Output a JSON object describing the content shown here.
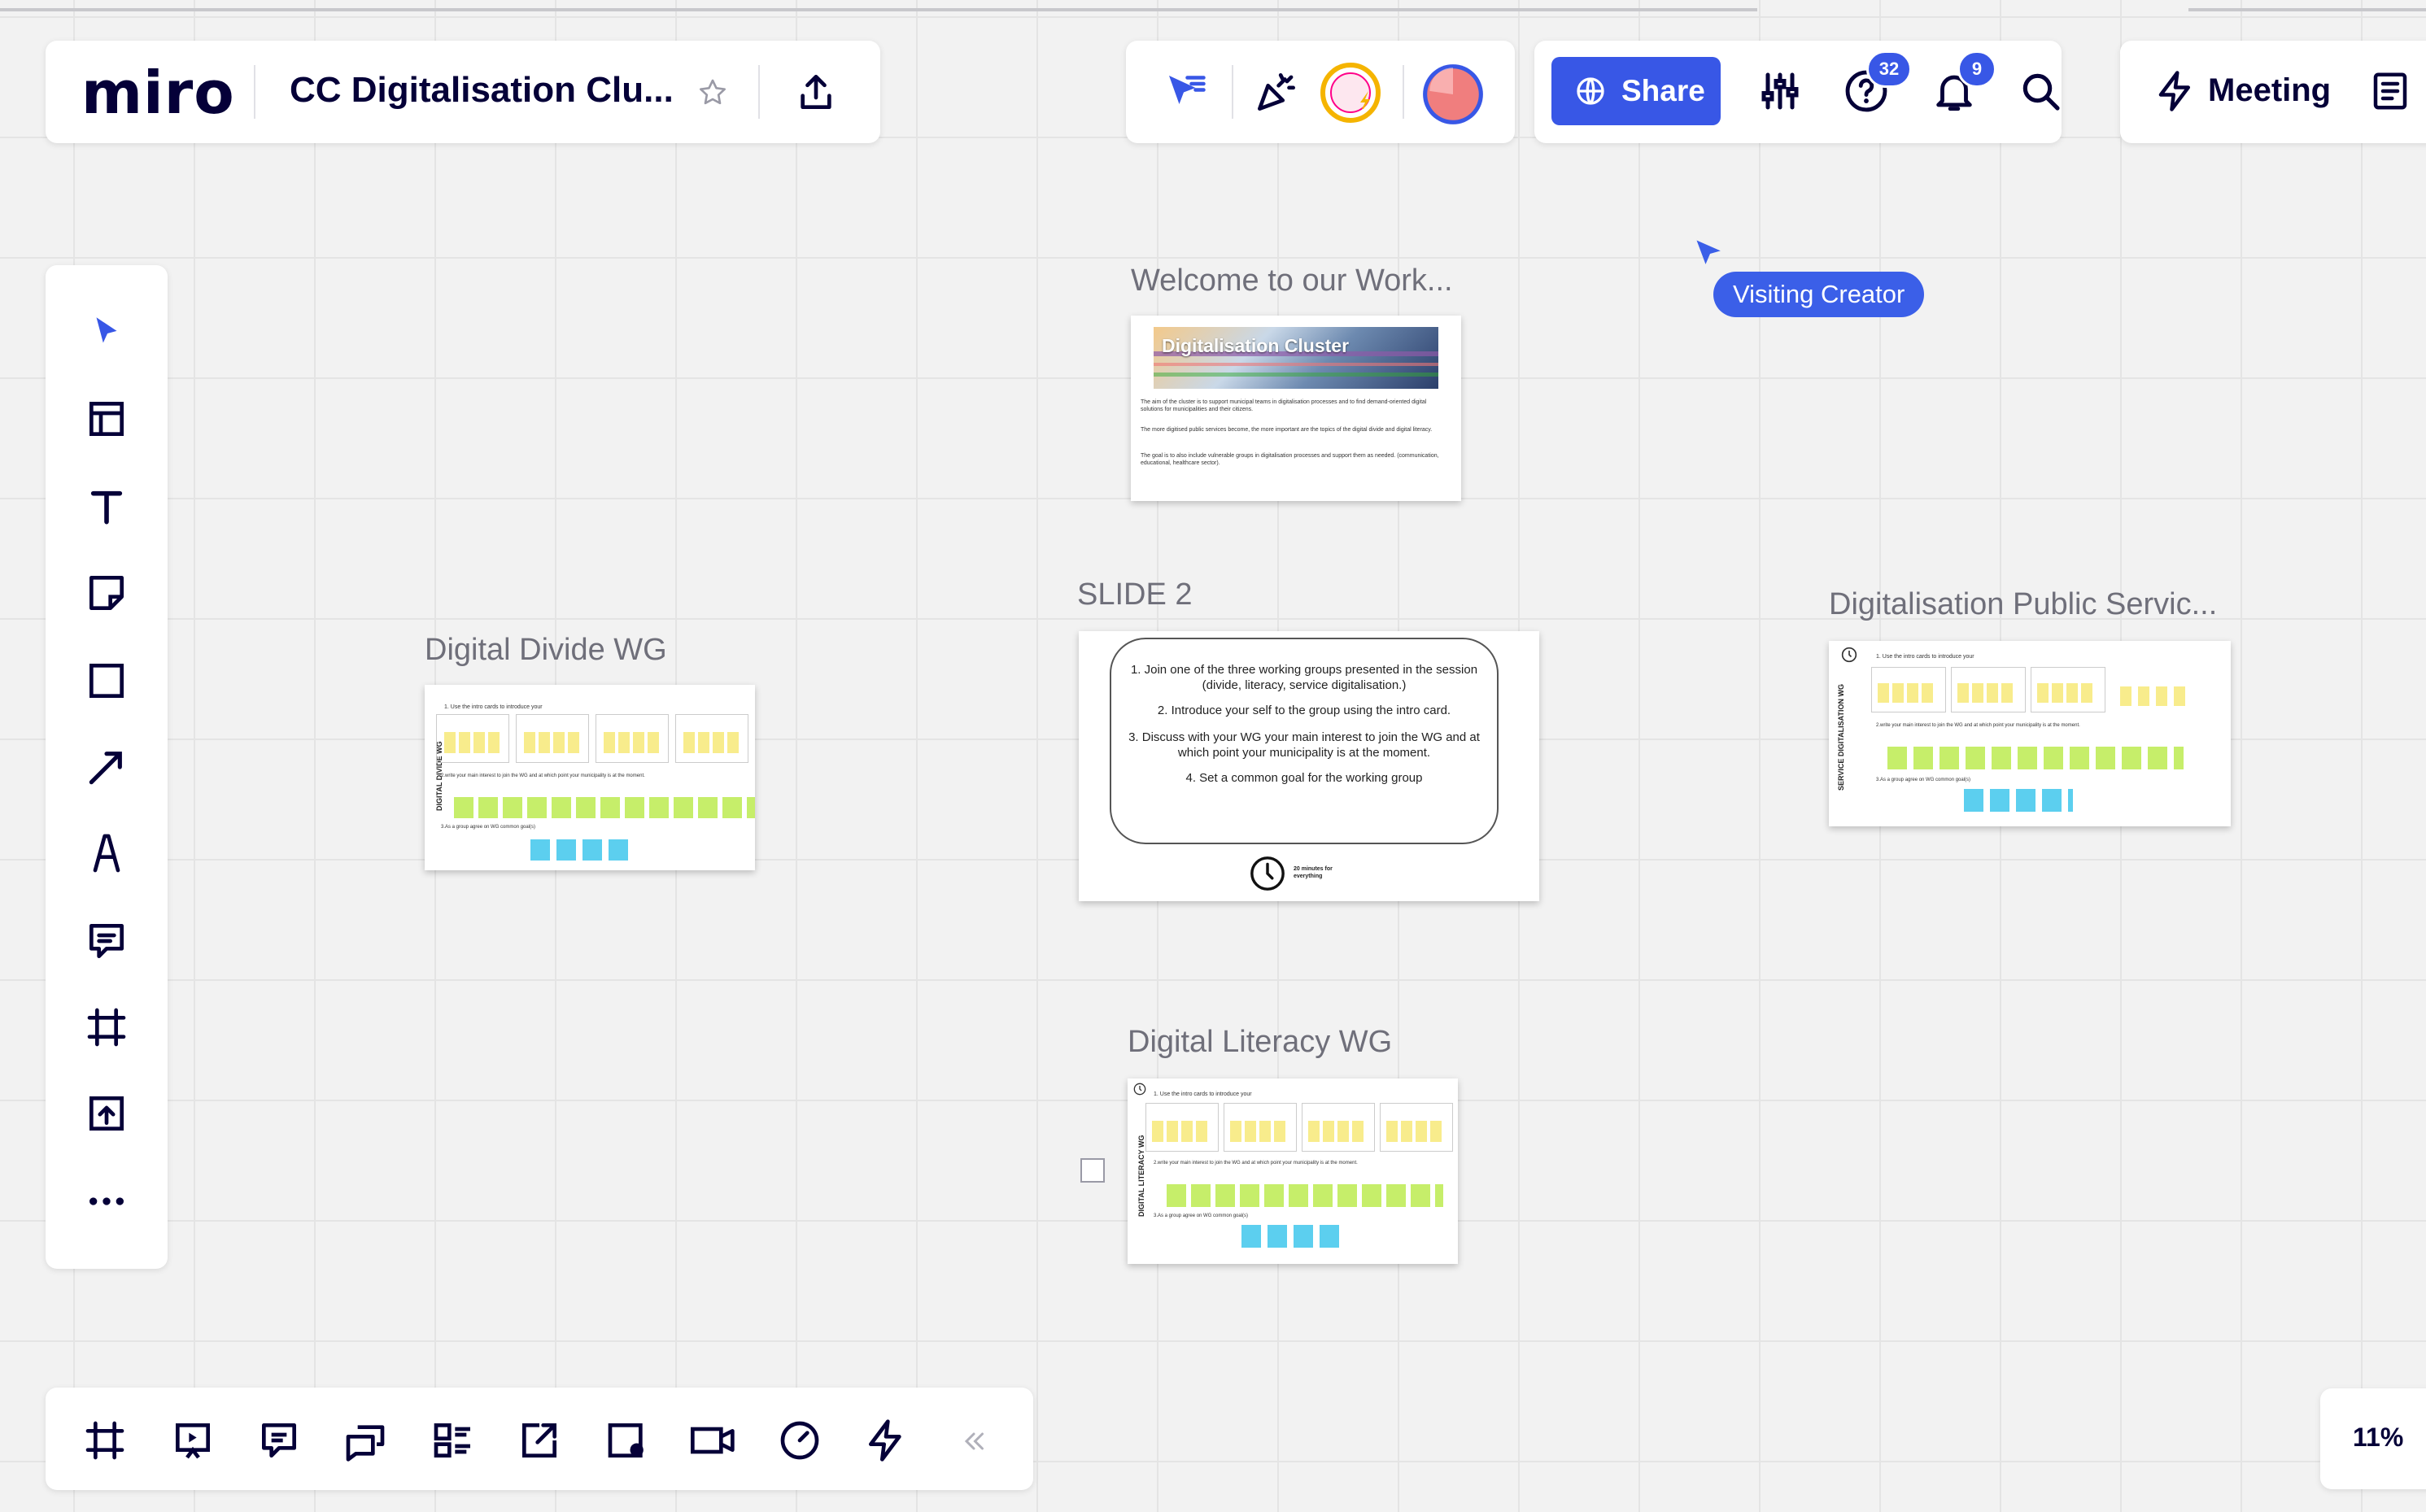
{
  "app": {
    "logo": "miro"
  },
  "board": {
    "title": "CC Digitalisation Clu..."
  },
  "toolbar": {
    "share_label": "Share",
    "help_badge": "32",
    "notifications_badge": "9",
    "meeting_label": "Meeting"
  },
  "cursor": {
    "label": "Visiting Creator"
  },
  "frames": {
    "welcome": {
      "title": "Welcome to our Work...",
      "banner": "Digitalisation Cluster",
      "p1": "The aim of the cluster is to support municipal teams in digitalisation processes and to find demand-oriented digital solutions for municipalities and their citizens.",
      "p2": "The more digitised public services become, the more important are the topics of the digital divide and digital literacy.",
      "p3": "The goal is to also include vulnerable groups in digitalisation processes and support them as needed. (communication, educational, healthcare sector)."
    },
    "slide2": {
      "title": "SLIDE 2",
      "line1": "1. Join one of the three working groups presented in the session (divide, literacy, service digitalisation.)",
      "line2": "2. Introduce your self to the group using the intro card.",
      "line3": "3. Discuss with your WG your main interest to join the WG and at which point your municipality is at the moment.",
      "line4": "4. Set a common goal for the working group",
      "timer": "20 minutes for everything"
    },
    "divide": {
      "title": "Digital Divide WG",
      "side_label": "DIGITAL DIVIDE WG",
      "step1": "1. Use the intro cards to introduce your",
      "step2": "2.write your main interest to join the WG and at which point your municipality is at the moment.",
      "step3": "3.As a group agree on WG common goal(s)"
    },
    "service": {
      "title": "Digitalisation Public Servic...",
      "side_label": "SERVICE DIGITALISATION WG",
      "step1": "1. Use the intro cards to introduce your",
      "step2": "2.write your main interest to join the WG and at which point your municipality is at the moment.",
      "step3": "3.As a group agree on WG common goal(s)"
    },
    "literacy": {
      "title": "Digital Literacy WG",
      "side_label": "DIGITAL LITERACY WG",
      "step1": "1. Use the intro cards to introduce your",
      "step2": "2.write your main interest to join the WG and at which point your municipality is at the moment.",
      "step3": "3.As a group agree on WG common goal(s)"
    }
  },
  "zoom": {
    "level": "11%"
  },
  "colors": {
    "accent": "#3857e6",
    "sticky_yellow": "#f8ec8c",
    "sticky_green": "#c6ee6a",
    "sticky_blue": "#5ccfef"
  }
}
